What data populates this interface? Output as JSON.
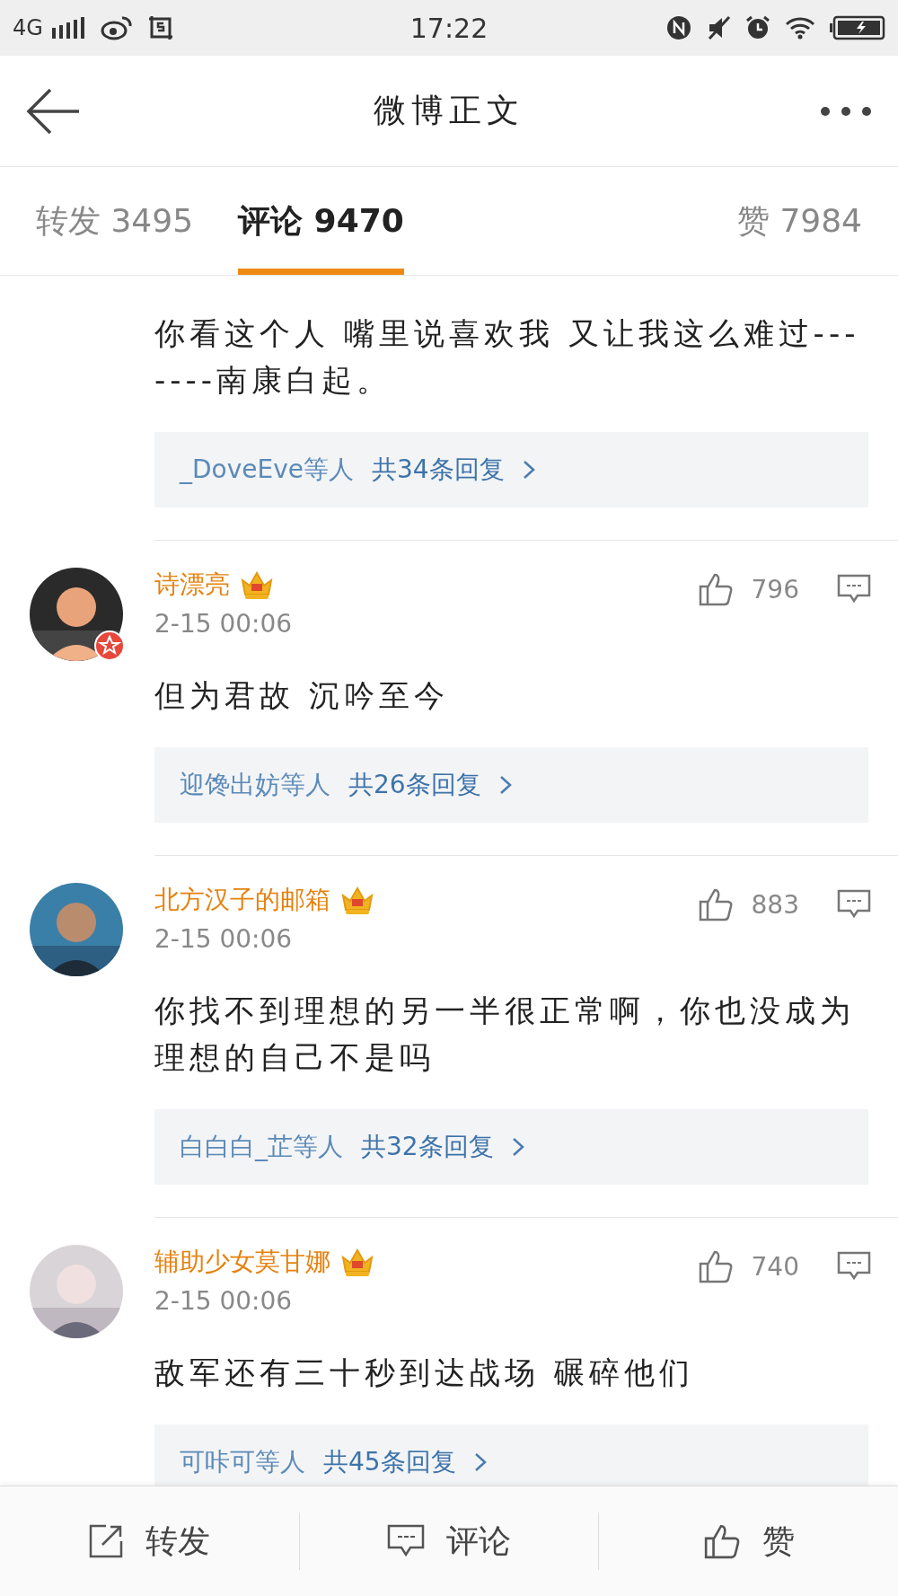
{
  "status_bar": {
    "network": "4G",
    "time": "17:22"
  },
  "header": {
    "title": "微博正文"
  },
  "tabs": [
    {
      "label": "转发",
      "count": "3495",
      "selected": false
    },
    {
      "label": "评论",
      "count": "9470",
      "selected": true
    },
    {
      "label": "赞",
      "count": "7984",
      "selected": false
    }
  ],
  "comments": [
    {
      "text": "你看这个人 嘴里说喜欢我 又让我这么难过-------南康白起。",
      "replies": {
        "users": "_DoveEve等人",
        "count": "共34条回复"
      }
    },
    {
      "name": "诗漂亮",
      "verified": true,
      "time": "2-15 00:06",
      "likes": "796",
      "text": "但为君故 沉吟至今",
      "replies": {
        "users": "迎馋出妨等人",
        "count": "共26条回复"
      }
    },
    {
      "name": "北方汉子的邮箱",
      "verified": false,
      "time": "2-15 00:06",
      "likes": "883",
      "text": "你找不到理想的另一半很正常啊，你也没成为理想的自己不是吗",
      "replies": {
        "users": "白白白_芷等人",
        "count": "共32条回复"
      }
    },
    {
      "name": "辅助少女莫甘娜",
      "verified": false,
      "time": "2-15 00:06",
      "likes": "740",
      "text": "敌军还有三十秒到达战场 碾碎他们",
      "replies": {
        "users": "可咔可等人",
        "count": "共45条回复"
      }
    }
  ],
  "bottom_bar": [
    {
      "kind": "repost",
      "label": "转发"
    },
    {
      "kind": "comment",
      "label": "评论"
    },
    {
      "kind": "like",
      "label": "赞"
    }
  ]
}
